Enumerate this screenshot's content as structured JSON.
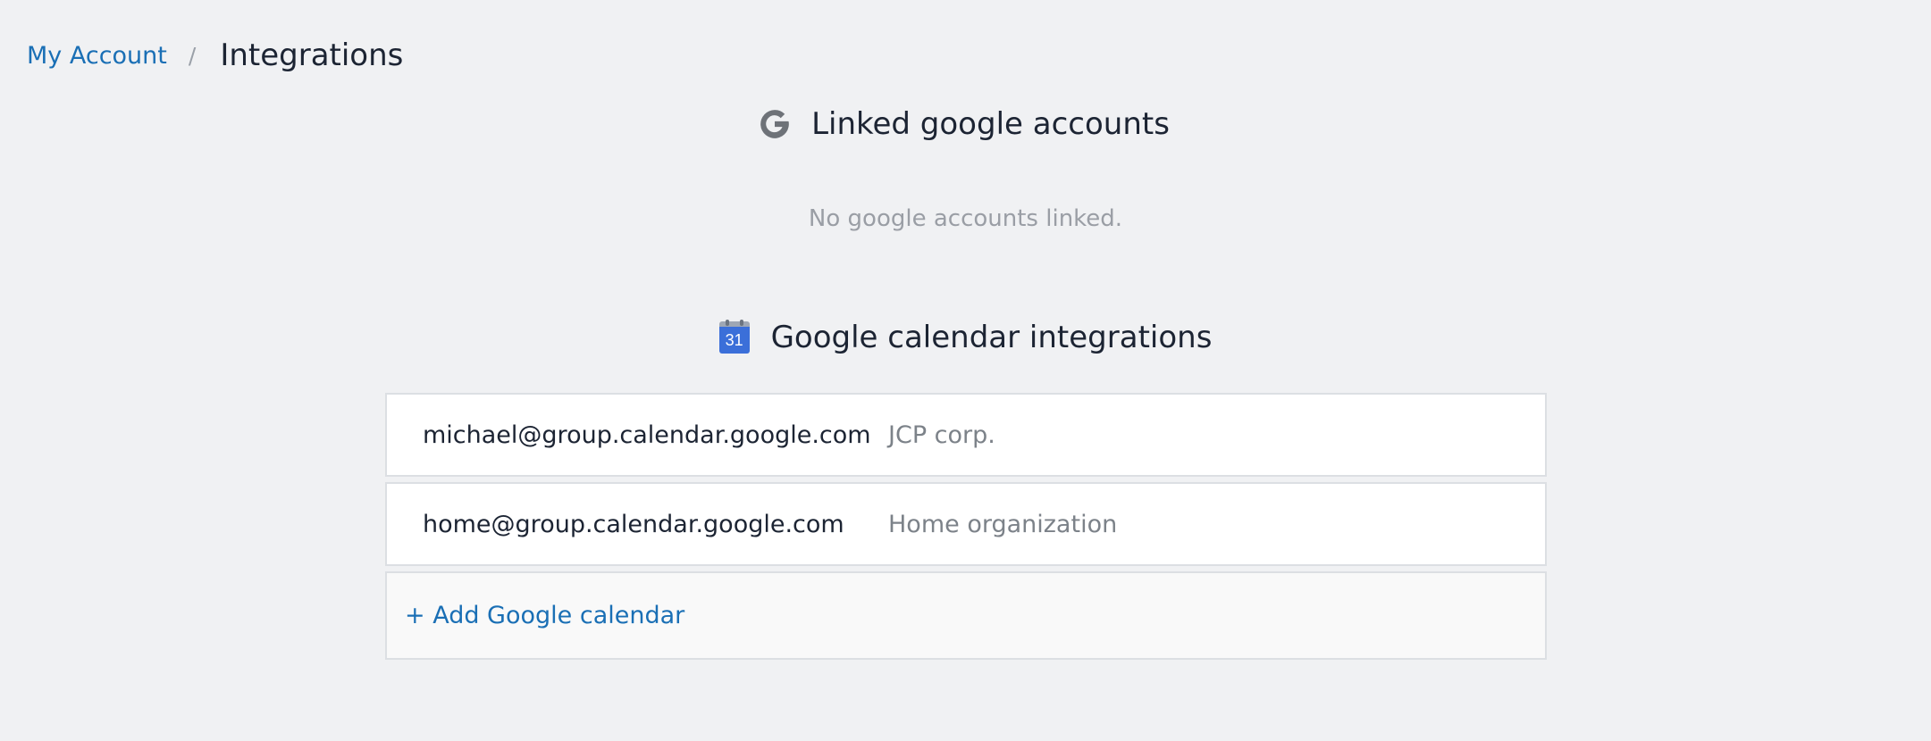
{
  "breadcrumb": {
    "parent_label": "My Account",
    "separator": "/",
    "current_label": "Integrations"
  },
  "google_accounts": {
    "title": "Linked google accounts",
    "icon": "google-g-icon",
    "empty_message": "No google accounts linked."
  },
  "calendar_integrations": {
    "title": "Google calendar integrations",
    "icon": "google-calendar-icon",
    "icon_day": "31",
    "rows": [
      {
        "email": "michael@group.calendar.google.com",
        "organization": "JCP corp."
      },
      {
        "email": "home@group.calendar.google.com",
        "organization": "Home organization"
      }
    ],
    "add_label": "+ Add Google calendar"
  },
  "colors": {
    "background": "#f0f1f3",
    "link": "#1a6fb5",
    "text": "#1c2433",
    "muted": "#9a9ea5",
    "calendar_blue": "#3b6fd9"
  }
}
